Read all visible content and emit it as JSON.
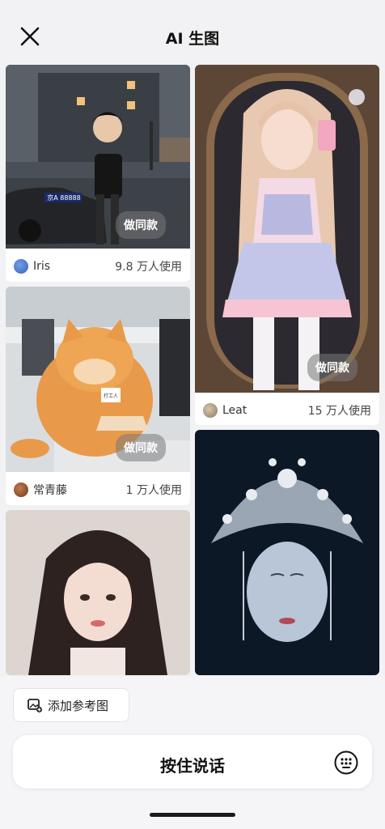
{
  "header": {
    "title": "AI 生图"
  },
  "cards": [
    {
      "action_label": "做同款",
      "author": "Iris",
      "usage": "9.8 万人使用",
      "plate": "京A 88888"
    },
    {
      "action_label": "做同款",
      "author": "Leat",
      "usage": "15 万人使用"
    },
    {
      "action_label": "做同款",
      "author": "常青藤",
      "usage": "1 万人使用",
      "badge": "打工人"
    },
    {
      "author": "",
      "usage": ""
    },
    {
      "author": "",
      "usage": ""
    }
  ],
  "bottom": {
    "ref_label": "添加参考图",
    "speak_label": "按住说话"
  },
  "colors": {
    "background": "#f2f2f4",
    "card": "#ffffff",
    "action_overlay": "rgba(120,120,120,0.55)"
  }
}
